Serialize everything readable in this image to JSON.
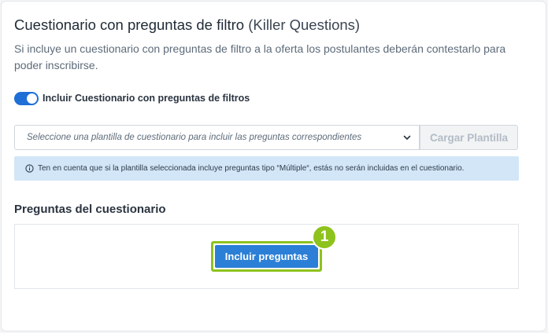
{
  "header": {
    "title_main": "Cuestionario con preguntas de filtro",
    "title_suffix": "(Killer Questions)",
    "description": "Si incluye un cuestionario con preguntas de filtro a la oferta los postulantes deberán contestarlo para poder inscribirse."
  },
  "toggle": {
    "label": "Incluir Cuestionario con preguntas de filtros",
    "state": "on"
  },
  "template_select": {
    "placeholder": "Seleccione una plantilla de cuestionario para incluir las preguntas correspondientes",
    "load_button_label": "Cargar Plantilla"
  },
  "info_note": {
    "icon": "info-circle-icon",
    "text": "Ten en cuenta que si la plantilla seleccionada incluye preguntas tipo “Múltiple“, estás no serán incluidas en el cuestionario."
  },
  "questions": {
    "section_title": "Preguntas del cuestionario",
    "include_button_label": "Incluir preguntas",
    "step_badge": "1"
  },
  "colors": {
    "accent": "#1f6fd6",
    "button": "#2b7fd6",
    "highlight": "#8ec21d",
    "info_bg": "#d2e6f8"
  }
}
